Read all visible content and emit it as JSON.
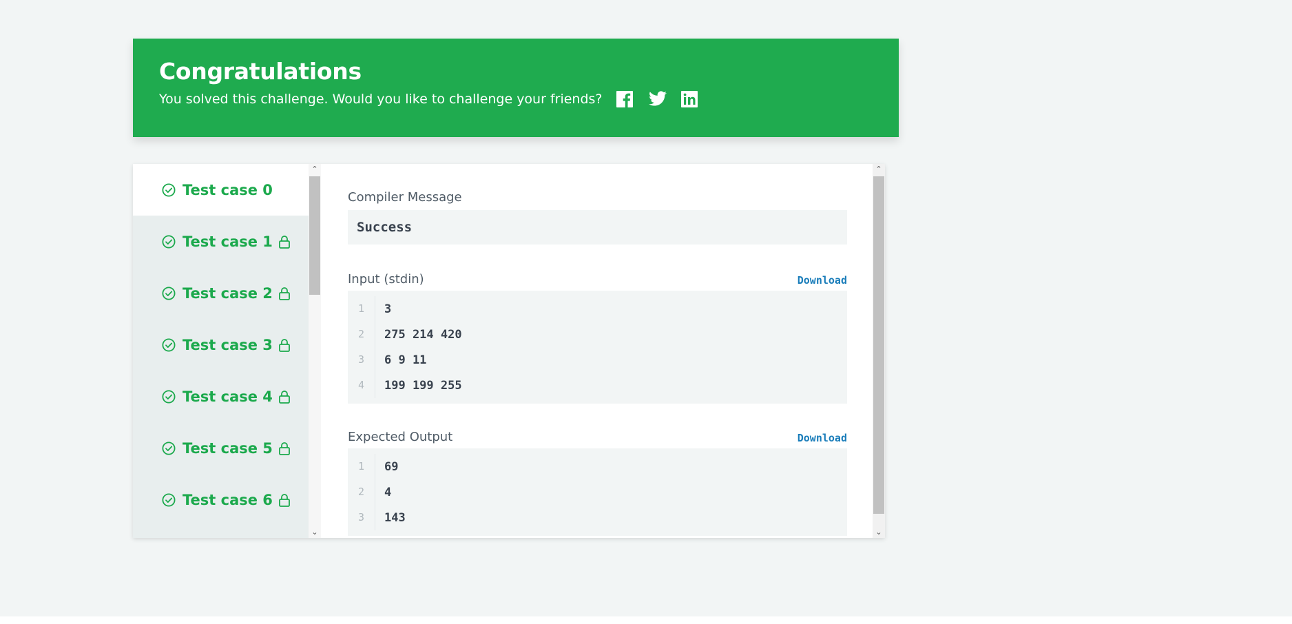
{
  "banner": {
    "title": "Congratulations",
    "subtitle": "You solved this challenge. Would you like to challenge your friends?",
    "share_icons": [
      "facebook-icon",
      "twitter-icon",
      "linkedin-icon"
    ],
    "color": "#1fab4f"
  },
  "test_cases": [
    {
      "label": "Test case 0",
      "locked": false,
      "active": true
    },
    {
      "label": "Test case 1",
      "locked": true,
      "active": false
    },
    {
      "label": "Test case 2",
      "locked": true,
      "active": false
    },
    {
      "label": "Test case 3",
      "locked": true,
      "active": false
    },
    {
      "label": "Test case 4",
      "locked": true,
      "active": false
    },
    {
      "label": "Test case 5",
      "locked": true,
      "active": false
    },
    {
      "label": "Test case 6",
      "locked": true,
      "active": false
    }
  ],
  "compiler": {
    "label": "Compiler Message",
    "message": "Success"
  },
  "input": {
    "label": "Input (stdin)",
    "download_label": "Download",
    "lines": [
      {
        "n": "1",
        "text": "3"
      },
      {
        "n": "2",
        "text": "275 214 420"
      },
      {
        "n": "3",
        "text": "6 9 11"
      },
      {
        "n": "4",
        "text": "199 199 255"
      }
    ]
  },
  "expected": {
    "label": "Expected Output",
    "download_label": "Download",
    "lines": [
      {
        "n": "1",
        "text": "69"
      },
      {
        "n": "2",
        "text": "4"
      },
      {
        "n": "3",
        "text": "143"
      }
    ]
  },
  "colors": {
    "success": "#1ba94c",
    "link": "#1a7dba",
    "page_bg": "#f2f5f5"
  }
}
